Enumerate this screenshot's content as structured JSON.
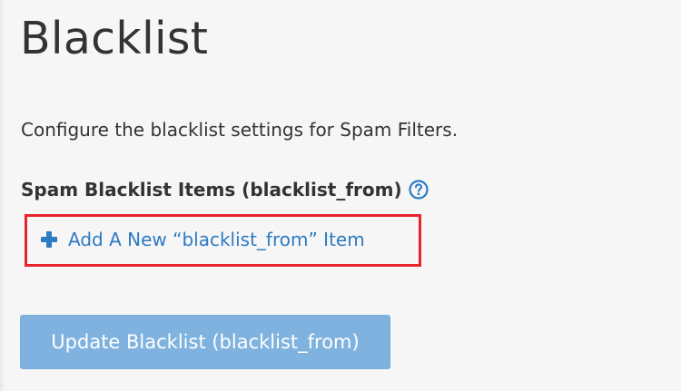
{
  "page": {
    "title": "Blacklist",
    "description": "Configure the blacklist settings for Spam Filters."
  },
  "section": {
    "heading": "Spam Blacklist Items (blacklist_from)",
    "help_icon": "question-circle-icon"
  },
  "add_item": {
    "icon": "plus-icon",
    "label": "Add A New “blacklist_from” Item"
  },
  "update_button": {
    "label": "Update Blacklist (blacklist_from)"
  },
  "colors": {
    "background": "#f6f6f6",
    "text": "#333333",
    "link": "#2d7bc3",
    "highlight_box": "#e8242c",
    "button_disabled": "#7fb2df"
  }
}
